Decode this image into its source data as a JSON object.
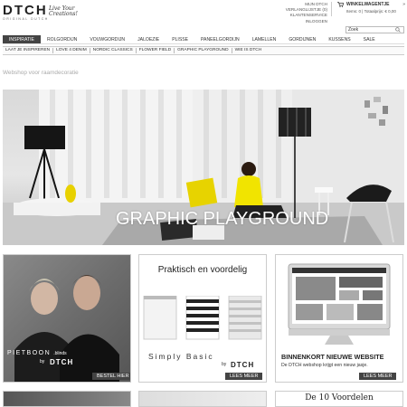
{
  "header": {
    "logo": "DTCH",
    "logo_sub": "ORIGINAL DUTCH",
    "tagline": "Live Your Creations!",
    "top_links": [
      "MIJN DTCH",
      "VERLANGLIJSTJE (0)",
      "KLANTENSERVICE",
      "INLOGGEN"
    ],
    "cart_title": "WINKELWAGENTJE",
    "cart_arrow": "»",
    "cart_info": "Items: 0 | Totaalprijs: € 0,00",
    "search_placeholder": "Zoek"
  },
  "mainnav": [
    "INSPIRATIE",
    "ROLGORDIJN",
    "VOUWGORDIJN",
    "JALOEZIE",
    "PLISSE",
    "PANEELGORDIJN",
    "LAMELLEN",
    "GORDIJNEN",
    "KUSSENS",
    "SALE"
  ],
  "subnav": [
    "LAAT JE INSPIREREN",
    "LOVE 4 DENIM",
    "NORDIC CLASSICS",
    "FLOWER FIELD",
    "GRAPHIC PLAYGROUND",
    "WIE IS DTCH"
  ],
  "breadcrumb": "Webshop voor raamdecoratie",
  "hero": {
    "title": "GRAPHIC PLAYGROUND"
  },
  "promo1": {
    "label": "PIETBOON",
    "label_suffix": ".blinds",
    "by": "by",
    "logo": "DTCH",
    "button": "BESTEL HIER"
  },
  "promo2": {
    "title": "Praktisch en voordelig",
    "brand": "Simply Basic",
    "by": "by",
    "logo": "DTCH",
    "button": "LEES MEER"
  },
  "promo3": {
    "heading": "BINNENKORT NIEUWE WEBSITE",
    "text": "De DTCH webshop krijgt een nieuw jasje.",
    "button": "LEES MEER"
  },
  "bottom3": {
    "text": "De 10 Voordelen"
  },
  "colors": {
    "nav_active": "#444444",
    "button": "#444444",
    "breadcrumb": "#aaaaaa"
  }
}
